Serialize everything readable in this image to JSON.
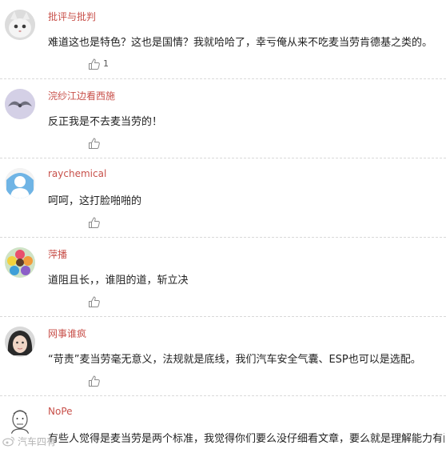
{
  "comments": [
    {
      "username": "批评与批判",
      "text": "难道这也是特色？这也是国情？我就哈哈了，幸亏俺从来不吃麦当劳肯德基之类的。",
      "likes": "1",
      "avatar": "cat-avatar"
    },
    {
      "username": "浣纱江边看西施",
      "text": "反正我是不去麦当劳的！",
      "likes": "",
      "avatar": "bird-avatar"
    },
    {
      "username": "raychemical",
      "text": "呵呵，这打脸啪啪的",
      "likes": "",
      "avatar": "default-avatar"
    },
    {
      "username": "萍播",
      "text": "道阻且长，，谁阻的道，斩立决",
      "likes": "",
      "avatar": "flower-avatar"
    },
    {
      "username": "网事谁疯",
      "text": "“苛责”麦当劳毫无意义，法规就是底线，我们汽车安全气囊、ESP也可以是选配。",
      "likes": "",
      "avatar": "girl-avatar"
    },
    {
      "username": "NoPe",
      "text": "有些人觉得是麦当劳是两个标准，我觉得你们要么没仔细看文章，要么就是理解能力有问题",
      "likes": "",
      "avatar": "sketch-avatar"
    }
  ],
  "watermark": {
    "text": "汽车四有"
  },
  "icons": {
    "like": "thumbs-up-icon",
    "watermark": "weibo-icon"
  }
}
